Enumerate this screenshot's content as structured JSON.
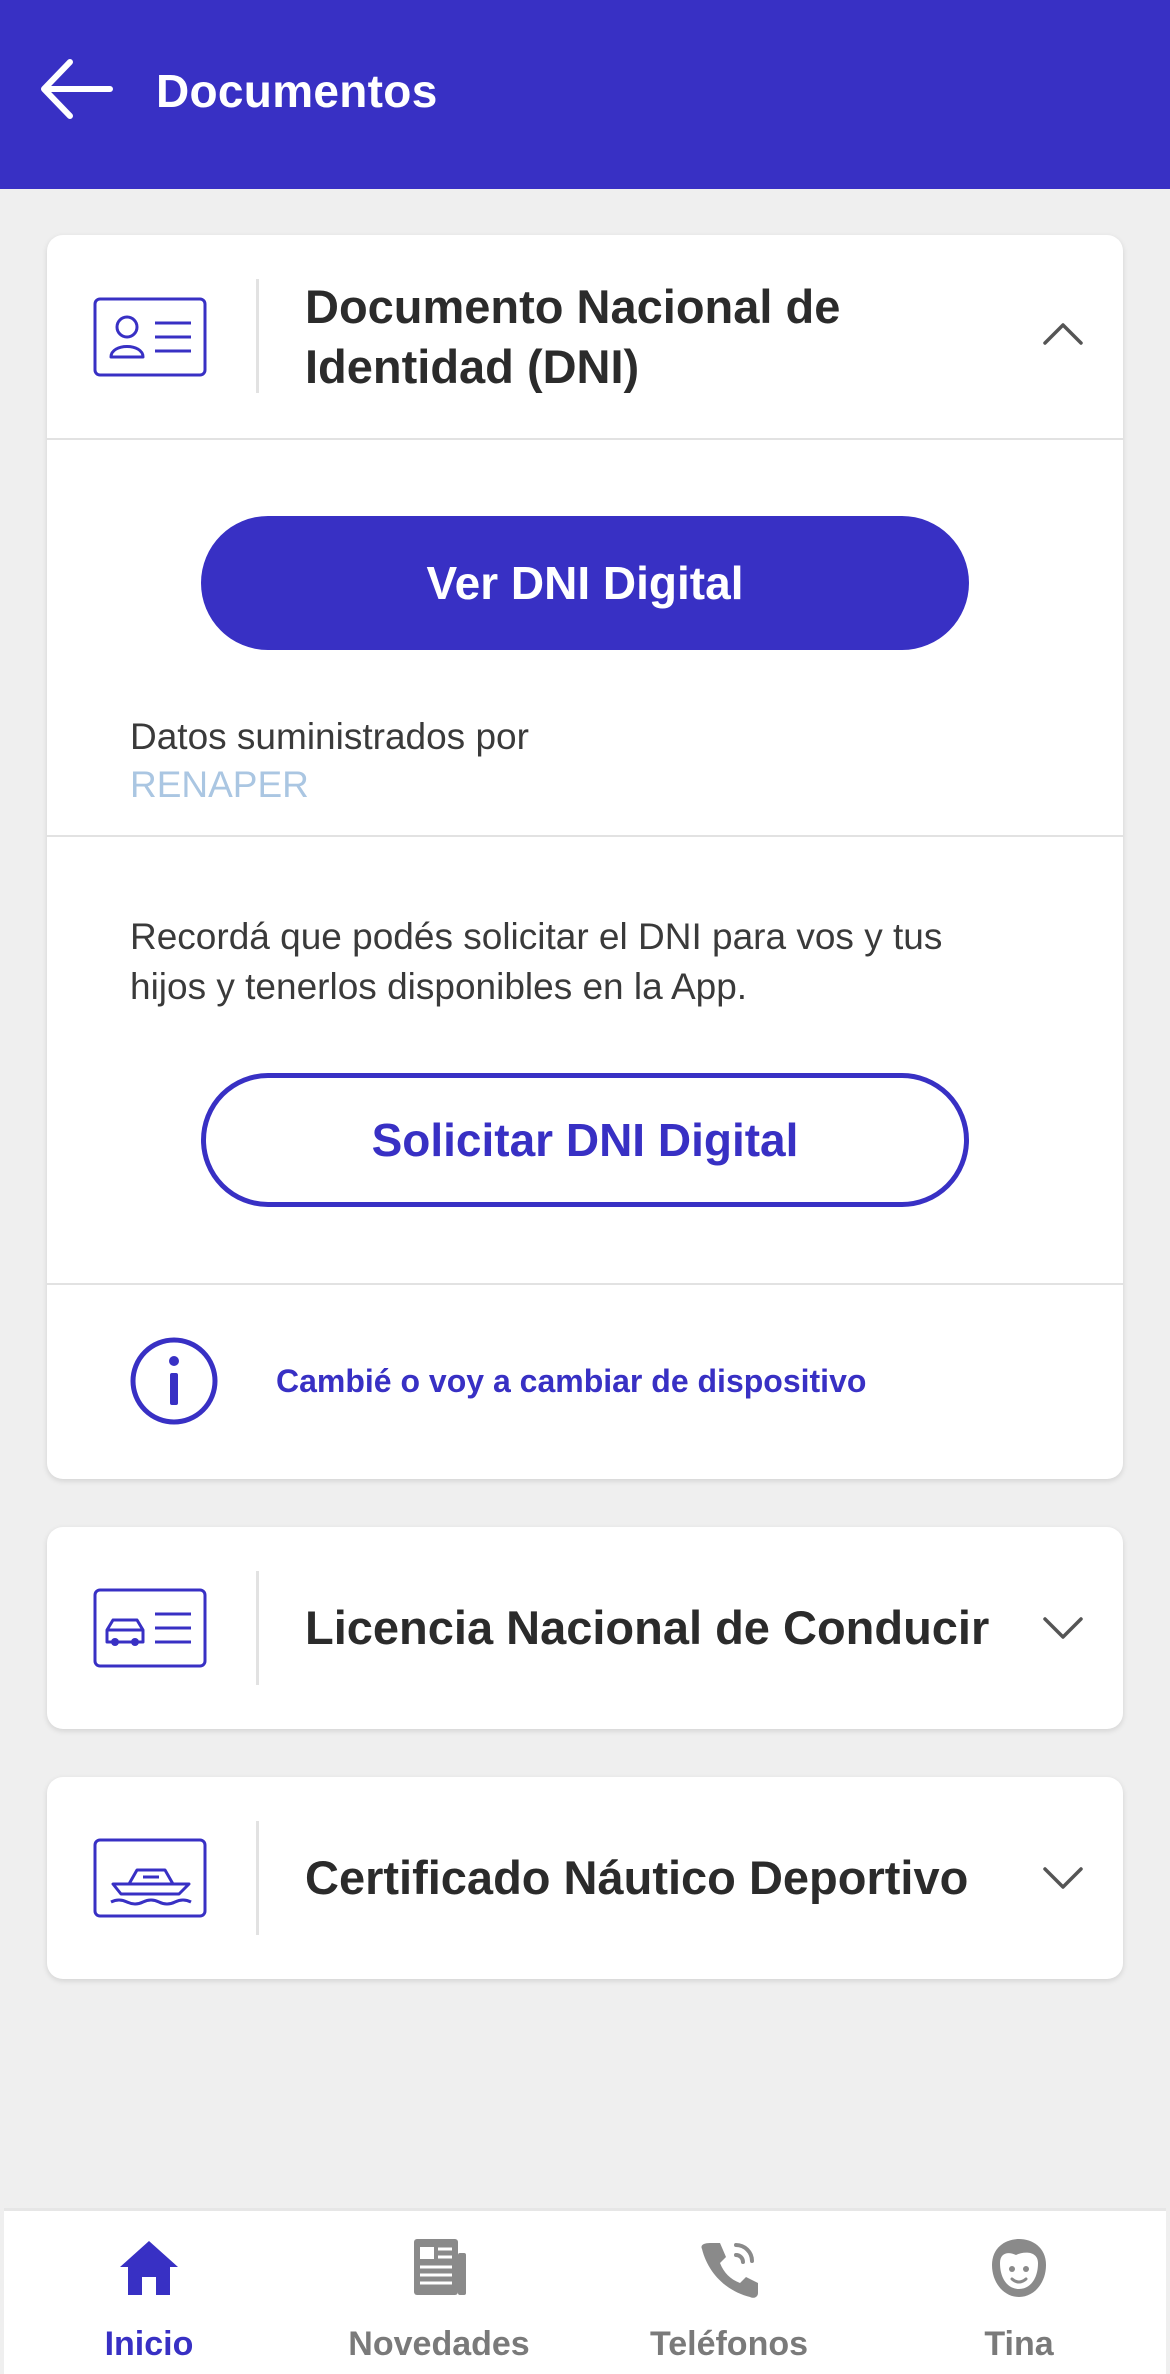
{
  "header": {
    "title": "Documentos"
  },
  "dni_card": {
    "title_line1": "Documento Nacional de",
    "title_line2": "Identidad (DNI)",
    "view_button": "Ver DNI Digital",
    "source_label": "Datos suministrados por",
    "source_link": "RENAPER",
    "reminder_line1": "Recordá que podés solicitar el DNI para vos y tus",
    "reminder_line2": "hijos y tenerlos disponibles en la App.",
    "request_button": "Solicitar DNI Digital",
    "device_link": "Cambié o voy a cambiar de dispositivo",
    "expanded": true
  },
  "license_card": {
    "title": "Licencia Nacional de Conducir",
    "expanded": false
  },
  "nautical_card": {
    "title": "Certificado Náutico Deportivo",
    "expanded": false
  },
  "bottom_nav": [
    {
      "label": "Inicio",
      "icon": "home-icon",
      "active": true
    },
    {
      "label": "Novedades",
      "icon": "news-icon",
      "active": false
    },
    {
      "label": "Teléfonos",
      "icon": "phone-icon",
      "active": false
    },
    {
      "label": "Tina",
      "icon": "tina-avatar-icon",
      "active": false
    }
  ],
  "colors": {
    "primary": "#3830c4",
    "background": "#efefef",
    "link_muted": "#aac6e2",
    "nav_inactive": "#7a7a7a"
  }
}
